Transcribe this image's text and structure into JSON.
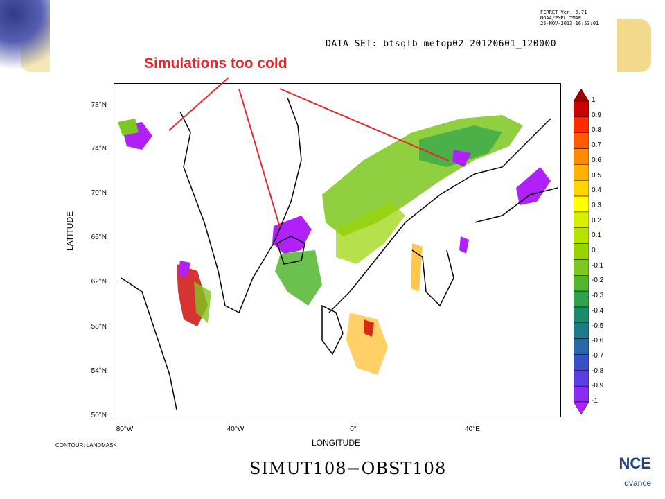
{
  "header": {
    "ferret_line1": "FERRET Ver. 6.71",
    "ferret_line2": "NOAA/PMEL TMAP",
    "ferret_line3": "25-NOV-2013 16:53:01",
    "dataset": "DATA SET: btsqlb  metop02  20120601_120000"
  },
  "annotation": {
    "callout": "Simulations too cold",
    "arrow_color": "#e8252d"
  },
  "axes": {
    "ylabel": "LATITUDE",
    "xlabel": "LONGITUDE",
    "lat_ticks": [
      "78°N",
      "74°N",
      "70°N",
      "66°N",
      "62°N",
      "58°N",
      "54°N",
      "50°N"
    ],
    "lon_ticks": [
      "80°W",
      "40°W",
      "0°",
      "40°E"
    ]
  },
  "colorbar": {
    "labels": [
      "1",
      "0.9",
      "0.8",
      "0.7",
      "0.6",
      "0.5",
      "0.4",
      "0.3",
      "0.2",
      "0.1",
      "0",
      "-0.1",
      "-0.2",
      "-0.3",
      "-0.4",
      "-0.5",
      "-0.6",
      "-0.7",
      "-0.8",
      "-0.9",
      "-1"
    ],
    "colors": [
      "#a00000",
      "#cc0000",
      "#ff2a00",
      "#ff5a00",
      "#ff8a00",
      "#ffb000",
      "#ffd400",
      "#ffff00",
      "#d8f000",
      "#b6e400",
      "#98d400",
      "#7cc81e",
      "#52b52e",
      "#2ea34a",
      "#1a8c6a",
      "#1e7a8a",
      "#2a66a8",
      "#3a50c8",
      "#5a3ee0",
      "#8a2cf0",
      "#b020f8"
    ]
  },
  "footer": {
    "contour_note": "CONTOUR: LANDMASK",
    "expression": "SIMUT108−OBST108",
    "logo_text": "NCE",
    "logo_sub": "dvance"
  }
}
